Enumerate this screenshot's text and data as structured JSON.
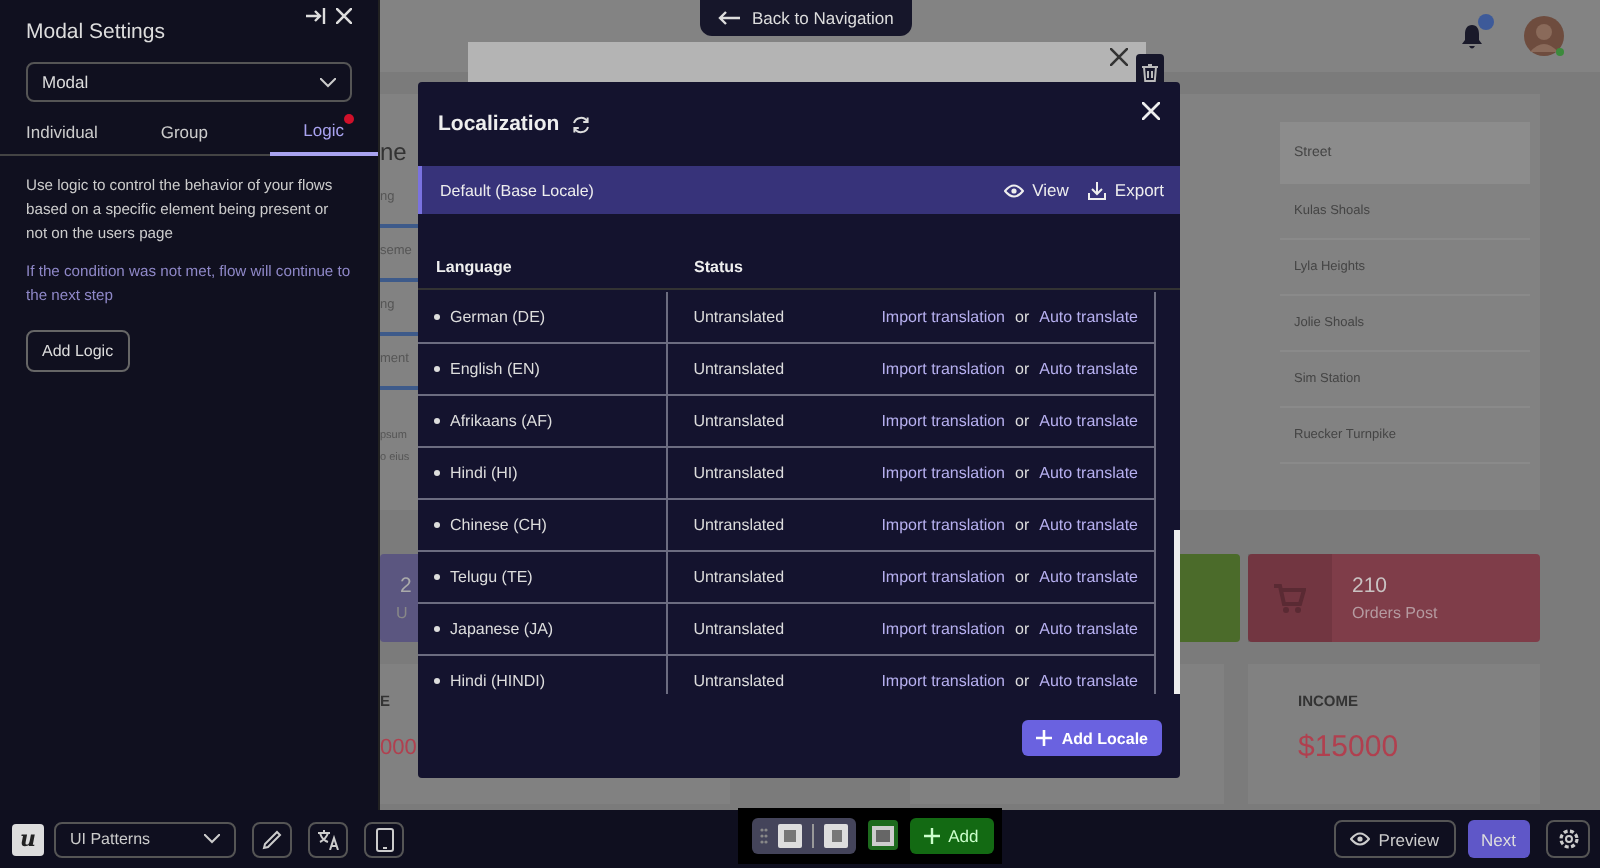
{
  "sidebar": {
    "title": "Modal Settings",
    "dropdown": "Modal",
    "tabs": [
      {
        "label": "Individual",
        "selected": false,
        "alert": false
      },
      {
        "label": "Group",
        "selected": false,
        "alert": false
      },
      {
        "label": "Logic",
        "selected": true,
        "alert": true
      }
    ],
    "description": "Use logic to control the behavior of your flows based on a specific element being present or not on the users page",
    "note": "If the condition was not met, flow will continue to the next step",
    "button": "Add Logic"
  },
  "back_button": "Back to Navigation",
  "dashboard": {
    "fragments": [
      "ng",
      "seme",
      "ng",
      "ment"
    ],
    "heading_fragment": "ne",
    "paragraph_fragments": [
      "psum",
      "o eius"
    ],
    "table": {
      "column": "Street",
      "rows": [
        "Kulas Shoals",
        "Lyla Heights",
        "Jolie Shoals",
        "Sim Station",
        "Ruecker Turnpike"
      ]
    },
    "stats": [
      {
        "value": "2",
        "label": "U",
        "color": "#5b5680"
      },
      {
        "color": "#4b6b2a"
      },
      {
        "value": "210",
        "label": "Orders Post",
        "color": "#7f3d49"
      }
    ],
    "cards": [
      {
        "kind": "amount",
        "title": "E",
        "amount": "000"
      },
      {
        "kind": "blank"
      },
      {
        "kind": "amount",
        "title": "INCOME",
        "amount": "$15000"
      }
    ]
  },
  "modal": {
    "title": "Localization",
    "base": {
      "label": "Default (Base Locale)",
      "view": "View",
      "export": "Export"
    },
    "columns": [
      "Language",
      "Status"
    ],
    "rows": [
      {
        "language": "German (DE)",
        "status": "Untranslated",
        "import": "Import translation",
        "or": "or",
        "auto": "Auto translate"
      },
      {
        "language": "English (EN)",
        "status": "Untranslated",
        "import": "Import translation",
        "or": "or",
        "auto": "Auto translate"
      },
      {
        "language": "Afrikaans (AF)",
        "status": "Untranslated",
        "import": "Import translation",
        "or": "or",
        "auto": "Auto translate"
      },
      {
        "language": "Hindi (HI)",
        "status": "Untranslated",
        "import": "Import translation",
        "or": "or",
        "auto": "Auto translate"
      },
      {
        "language": "Chinese (CH)",
        "status": "Untranslated",
        "import": "Import translation",
        "or": "or",
        "auto": "Auto translate"
      },
      {
        "language": "Telugu (TE)",
        "status": "Untranslated",
        "import": "Import translation",
        "or": "or",
        "auto": "Auto translate"
      },
      {
        "language": "Japanese (JA)",
        "status": "Untranslated",
        "import": "Import translation",
        "or": "or",
        "auto": "Auto translate"
      },
      {
        "language": "Hindi (HINDI)",
        "status": "Untranslated",
        "import": "Import translation",
        "or": "or",
        "auto": "Auto translate"
      }
    ],
    "add_button": "Add Locale"
  },
  "toolbar": {
    "logo": "u",
    "pattern_select": "UI Patterns",
    "add_button": "Add",
    "preview_button": "Preview",
    "next_button": "Next"
  }
}
